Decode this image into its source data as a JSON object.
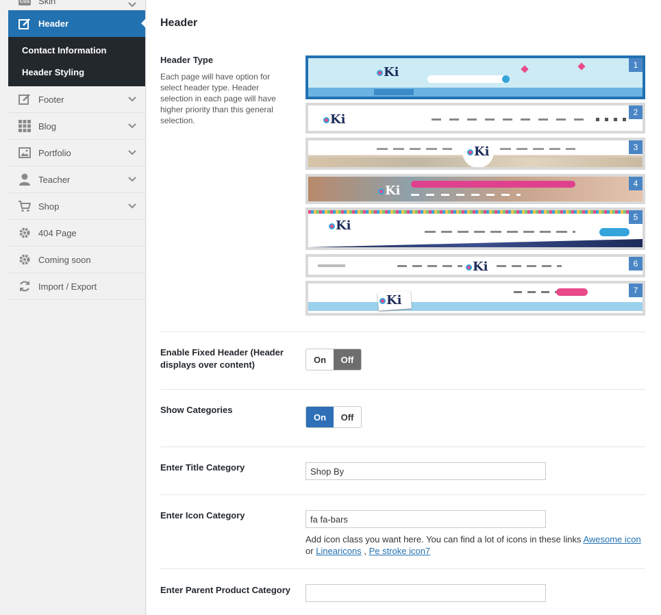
{
  "sidebar": {
    "items": [
      {
        "label": "Skin",
        "icon": "css-icon"
      },
      {
        "label": "Header",
        "icon": "edit-icon"
      },
      {
        "label": "Footer",
        "icon": "edit-icon"
      },
      {
        "label": "Blog",
        "icon": "grid-icon"
      },
      {
        "label": "Portfolio",
        "icon": "image-icon"
      },
      {
        "label": "Teacher",
        "icon": "person-icon"
      },
      {
        "label": "Shop",
        "icon": "cart-icon"
      },
      {
        "label": "404 Page",
        "icon": "gear-icon"
      },
      {
        "label": "Coming soon",
        "icon": "gear-icon"
      },
      {
        "label": "Import / Export",
        "icon": "refresh-icon"
      }
    ],
    "submenu": [
      "Contact Information",
      "Header Styling"
    ],
    "active_color": "#2271b1"
  },
  "main": {
    "title": "Header",
    "header_type": {
      "label": "Header Type",
      "description": "Each page will have option for select header type. Header selection in each page will have higher priority than this general selection.",
      "options": [
        "1",
        "2",
        "3",
        "4",
        "5",
        "6",
        "7"
      ],
      "selected": "1",
      "logo_text": "Ki"
    },
    "fixed_header": {
      "label": "Enable Fixed Header (Header displays over content)",
      "on": "On",
      "off": "Off",
      "value": "Off"
    },
    "show_categories": {
      "label": "Show Categories",
      "on": "On",
      "off": "Off",
      "value": "On"
    },
    "title_category": {
      "label": "Enter Title Category",
      "value": "Shop By"
    },
    "icon_category": {
      "label": "Enter Icon Category",
      "value": "fa fa-bars",
      "help_text": "Add icon class you want here. You can find a lot of icons in these links",
      "link1": "Awesome icon",
      "or": "or",
      "link2": "Linearicons",
      "sep": ",",
      "link3": "Pe stroke icon7"
    },
    "parent_category": {
      "label": "Enter Parent Product Category",
      "value": ""
    }
  }
}
